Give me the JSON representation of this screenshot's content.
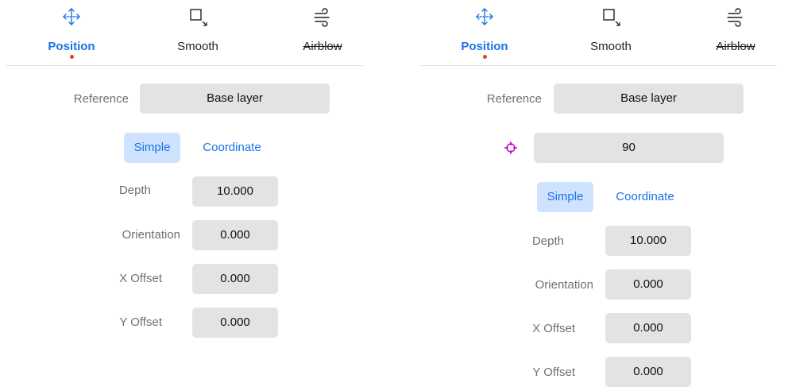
{
  "tabs": [
    {
      "label": "Position",
      "icon": "move-arrows-icon",
      "active": true
    },
    {
      "label": "Smooth",
      "icon": "smooth-corner-icon",
      "active": false
    },
    {
      "label": "Airblow",
      "icon": "wind-icon",
      "active": false
    }
  ],
  "reference": {
    "label": "Reference",
    "value": "Base layer"
  },
  "angle": {
    "value": "90",
    "icon": "crosshair-icon"
  },
  "mode": {
    "simple": "Simple",
    "coordinate": "Coordinate",
    "selected": "Simple"
  },
  "fields": [
    {
      "label": "Depth",
      "value": "10.000"
    },
    {
      "label": "Orientation",
      "value": "0.000"
    },
    {
      "label": "X Offset",
      "value": "0.000"
    },
    {
      "label": "Y Offset",
      "value": "0.000"
    }
  ],
  "colors": {
    "accent": "#1a73e8",
    "dot": "#e0432f",
    "crosshair": "#c000c0",
    "field_bg": "#e3e3e6"
  }
}
